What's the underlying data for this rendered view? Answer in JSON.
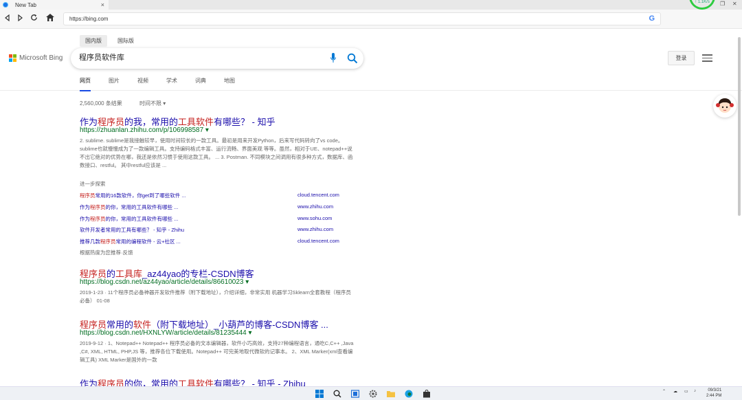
{
  "browser": {
    "tab_title": "New Tab",
    "tab_close": "×",
    "net_speed": "↑ 1.1K/s",
    "url": "https://bing.com",
    "address_search_icon": "G"
  },
  "header": {
    "scope_cn": "国内版",
    "scope_intl": "国际版",
    "brand": "Microsoft Bing",
    "query": "程序员软件库",
    "login": "登录",
    "verticals": [
      "网页",
      "图片",
      "视频",
      "学术",
      "词典",
      "地图"
    ]
  },
  "results": {
    "count": "2,560,000 条结果",
    "time_filter": "时间不限 ▾",
    "items": [
      {
        "title_pre": "作为",
        "title_hl1": "程序员",
        "title_mid": "的我，常用的",
        "title_hl2": "工具软件",
        "title_post": "有哪些？ - 知乎",
        "url": "https://zhuanlan.zhihu.com/p/106998587 ▾",
        "snippet": "2. sublime. sublime是我接触较早，使用时间较长的一款工具。最初是用来开发Python，后来写代码转向了vs code。sublime也就慢慢成为了一款编辑工具。支持编码格式丰富、运行流畅、界面美观 等等。虽然，相对于UE、notepad++说不出它绝对的优势在哪，我还是依然习惯于使用这款工具。 ... 3. Postman. 不同模块之间调用有很多种方式，数据库、函数接口、restful。 其中restful应该是 ..."
      },
      {
        "title_hl1": "程序员",
        "title_mid": "的",
        "title_hl2": "工具库",
        "title_post": "_az44yao的专栏-CSDN博客",
        "url": "https://blog.csdn.net/az44yao/article/details/86610023 ▾",
        "snippet": "2019-1-23 · 11个程序员必备神器开发软件推荐（附下载地址），介绍详细，非常实用 机器学习Sklearn全套教程（程序员 必备） 01-08"
      },
      {
        "title_hl1": "程序员",
        "title_mid": "常用的",
        "title_hl2": "软件",
        "title_post": "（附下载地址）_小葫芦的博客-CSDN博客 ...",
        "url": "https://blog.csdn.net/HXNLYW/article/details/81235444 ▾",
        "snippet": "2019-9-12 · 1、Notepad++ Notepad++ 程序员必备的文本编辑器，软件小巧高效，支持27种编程语言，通吃C,C++ ,Java ,C#, XML, HTML, PHP,JS 等，推荐各位下载使用。Notepad++ 可完美地取代微软的记事本。 2、XML Marker(xml查看编辑工具) XML Marker是国外的一款"
      },
      {
        "title_pre": "作为",
        "title_hl1": "程序员",
        "title_mid": "的你，常用的",
        "title_hl2": "工具软件",
        "title_post": "有哪些？ - 知乎 - Zhihu"
      }
    ],
    "related": {
      "heading": "进一步探索",
      "links": [
        {
          "pre": "",
          "hl": "程序员",
          "post": "常用的16款软件，你get到了哪些软件 ...",
          "domain": "cloud.tencent.com"
        },
        {
          "pre": "作为",
          "hl": "程序员",
          "post": "的你，常用的工具软件有哪些 ...",
          "domain": "www.zhihu.com"
        },
        {
          "pre": "作为",
          "hl": "程序员",
          "post": "的你，常用的工具软件有哪些 ...",
          "domain": "www.sohu.com"
        },
        {
          "pre": "软件开发者常用的工具有哪些？ - 知乎 - Zhihu",
          "hl": "",
          "post": "",
          "domain": "www.zhihu.com"
        },
        {
          "pre": "推荐几款",
          "hl": "程序员",
          "post": "常用的编程软件 - 云+社区 ...",
          "domain": "cloud.tencent.com"
        }
      ],
      "feedback": "根据热度为您推荐·反馈"
    }
  },
  "taskbar": {
    "clock_date": "09/3/21",
    "clock_time": "2:44 PM"
  },
  "colors": {
    "link_blue": "#1a0dab",
    "highlight_red": "#c5221f",
    "url_green": "#006d21",
    "bing_active_tab": "#174ae4"
  }
}
